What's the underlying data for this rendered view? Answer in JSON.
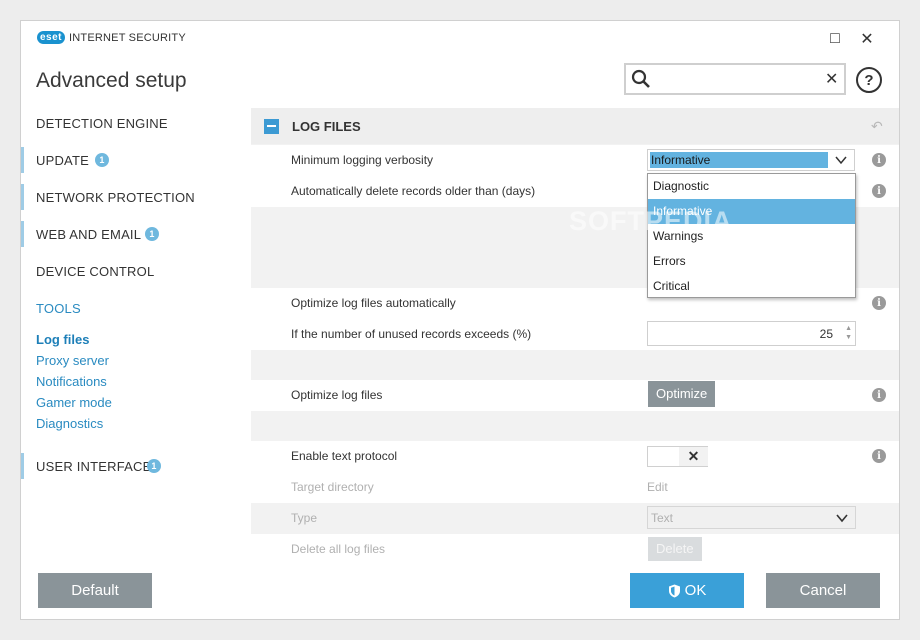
{
  "titlebar": {
    "logo_text": "eset",
    "product": "INTERNET SECURITY",
    "maximize_icon": "□",
    "close_icon": "✕"
  },
  "header": {
    "title": "Advanced setup",
    "search": {
      "value": "",
      "placeholder": "",
      "clear_icon": "✕"
    },
    "help_icon": "?"
  },
  "sidebar": {
    "items": [
      {
        "label": "DETECTION ENGINE"
      },
      {
        "label": "UPDATE",
        "badge": "1"
      },
      {
        "label": "NETWORK PROTECTION"
      },
      {
        "label": "WEB AND EMAIL",
        "badge": "1"
      },
      {
        "label": "DEVICE CONTROL"
      },
      {
        "label": "TOOLS"
      },
      {
        "label": "USER INTERFACE",
        "badge": "1"
      }
    ],
    "tools_sub": [
      "Log files",
      "Proxy server",
      "Notifications",
      "Gamer mode",
      "Diagnostics"
    ]
  },
  "panel": {
    "title": "LOG FILES",
    "rows": {
      "verbosity": {
        "label": "Minimum logging verbosity",
        "value": "Informative"
      },
      "auto_delete": {
        "label": "Automatically delete records older than (days)"
      },
      "optimize_auto": {
        "label": "Optimize log files automatically"
      },
      "unused": {
        "label": "If the number of unused records exceeds (%)",
        "value": "25"
      },
      "optimize": {
        "label": "Optimize log files",
        "button": "Optimize"
      },
      "text_protocol": {
        "label": "Enable text protocol",
        "toggle_icon": "✕"
      },
      "target_dir": {
        "label": "Target directory",
        "link": "Edit"
      },
      "type": {
        "label": "Type",
        "value": "Text"
      },
      "delete_all": {
        "label": "Delete all log files",
        "button": "Delete"
      }
    },
    "dropdown_options": [
      "Diagnostic",
      "Informative",
      "Warnings",
      "Errors",
      "Critical"
    ],
    "selected_option": "Informative",
    "info_icon": "i",
    "revert_icon": "↶"
  },
  "watermark": "SOFTPEDIA",
  "footer": {
    "default_label": "Default",
    "ok_label": "OK",
    "cancel_label": "Cancel"
  },
  "colors": {
    "accent": "#3aa0d8",
    "gray_button": "#8a9499",
    "selection": "#63b3e0"
  }
}
